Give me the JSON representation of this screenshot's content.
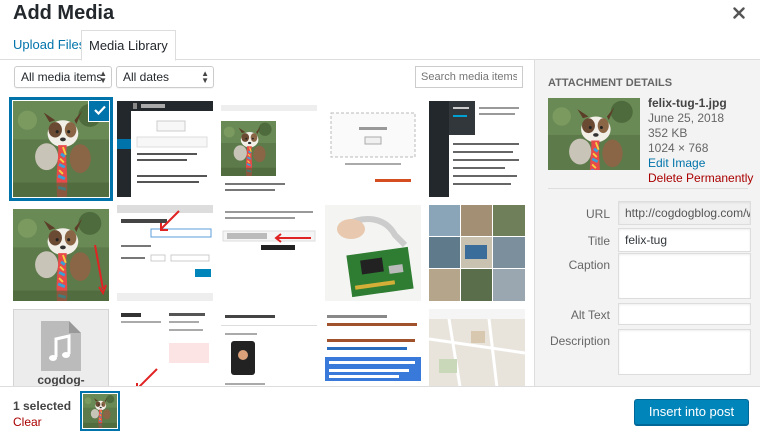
{
  "modal": {
    "title": "Add Media"
  },
  "tabs": [
    {
      "label": "Upload Files"
    },
    {
      "label": "Media Library"
    }
  ],
  "toolbar": {
    "type_filter": "All media items",
    "date_filter": "All dates",
    "search_placeholder": "Search media items..."
  },
  "grid": {
    "selected_index": 0,
    "audio_item_label": "cogdog-",
    "thumbs": [
      "dog-photo",
      "screenshot-editor",
      "dog-photo-in-post",
      "drop-files-screenshot",
      "code-editor-screenshot",
      "dog-photo-with-arrow",
      "insert-edit-image-dialog",
      "editor-toolbar-screenshot",
      "raspberry-pi-photo",
      "photo-collage",
      "audio-file",
      "blog-post-screenshot",
      "twitter-screenshot",
      "html-code-screenshot",
      "map-screenshot"
    ]
  },
  "attachment": {
    "header": "ATTACHMENT DETAILS",
    "filename": "felix-tug-1.jpg",
    "date": "June 25, 2018",
    "size": "352 KB",
    "dimensions": "1024 × 768",
    "edit_label": "Edit Image",
    "delete_label": "Delete Permanently",
    "url_label": "URL",
    "url_value": "http://cogdogblog.com/wp-",
    "title_label": "Title",
    "title_value": "felix-tug",
    "caption_label": "Caption",
    "caption_value": "",
    "alt_label": "Alt Text",
    "alt_value": "",
    "description_label": "Description",
    "description_value": ""
  },
  "footer": {
    "selected_count": "1 selected",
    "clear_label": "Clear",
    "insert_label": "Insert into post"
  },
  "colors": {
    "accent": "#0073aa",
    "button": "#0085ba",
    "danger": "#a00000"
  }
}
